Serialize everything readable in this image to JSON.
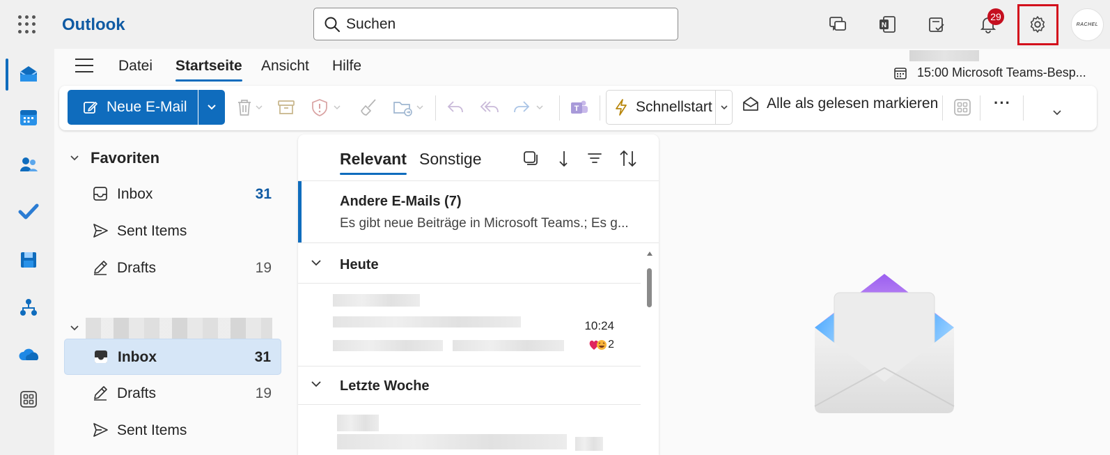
{
  "app": {
    "name": "Outlook"
  },
  "search": {
    "placeholder": "Suchen"
  },
  "topbar": {
    "notification_count": "29",
    "avatar_text": "RACHEL"
  },
  "menu": {
    "tabs": [
      {
        "label": "Datei"
      },
      {
        "label": "Startseite"
      },
      {
        "label": "Ansicht"
      },
      {
        "label": "Hilfe"
      }
    ],
    "active_tab": "Startseite"
  },
  "upcoming": {
    "label": "15:00 Microsoft Teams-Besp..."
  },
  "ribbon": {
    "new_mail_label": "Neue E-Mail",
    "quickstart_label": "Schnellstart",
    "mark_all_read_label": "Alle als gelesen markieren",
    "more_label": "···"
  },
  "folders": {
    "favorites_label": "Favoriten",
    "favorites": [
      {
        "label": "Inbox",
        "count": "31"
      },
      {
        "label": "Sent Items",
        "count": ""
      },
      {
        "label": "Drafts",
        "count": "19"
      }
    ],
    "account": [
      {
        "label": "Inbox",
        "count": "31"
      },
      {
        "label": "Drafts",
        "count": "19"
      },
      {
        "label": "Sent Items",
        "count": ""
      }
    ]
  },
  "message_list": {
    "tabs": [
      {
        "label": "Relevant"
      },
      {
        "label": "Sonstige"
      }
    ],
    "other_mails": {
      "title": "Andere E-Mails (7)",
      "preview": "Es gibt neue Beiträge in Microsoft Teams.; Es g..."
    },
    "groups": [
      {
        "label": "Heute"
      },
      {
        "label": "Letzte Woche"
      }
    ],
    "items": [
      {
        "time": "10:24",
        "reaction_count": "2"
      }
    ]
  },
  "colors": {
    "accent": "#0f6cbd",
    "brand_text": "#0f5aa3",
    "badge": "#c50f1f",
    "highlight": "#d3101c"
  }
}
